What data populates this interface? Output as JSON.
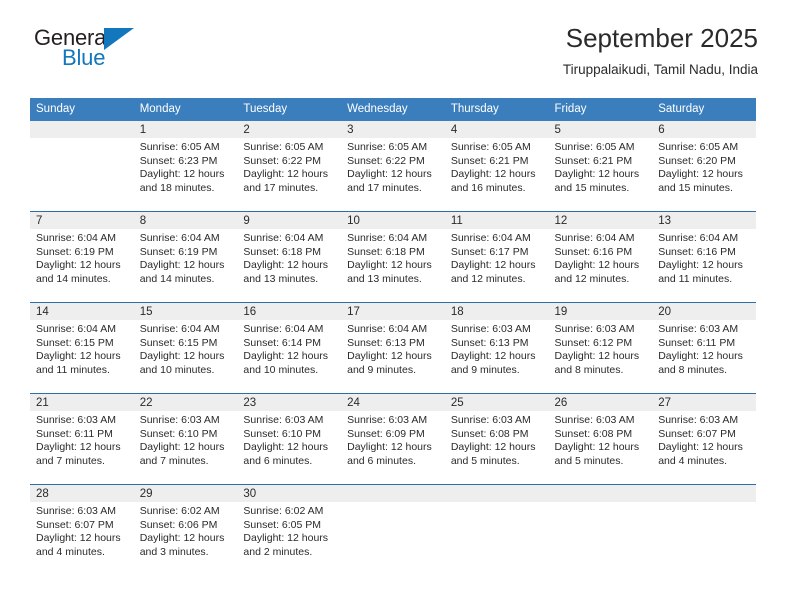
{
  "logo": {
    "text_top": "General",
    "text_bottom": "Blue",
    "triangle_icon": "triangle-icon",
    "color_dark": "#231f20",
    "color_blue": "#1277bc"
  },
  "header": {
    "title": "September 2025",
    "subtitle": "Tiruppalaikudi, Tamil Nadu, India"
  },
  "theme": {
    "header_blue": "#3b7ebe",
    "row_divider": "#2f6da8",
    "daynum_band": "#eeeeee",
    "text": "#2a2a2a"
  },
  "calendar": {
    "weekday_headers": [
      "Sunday",
      "Monday",
      "Tuesday",
      "Wednesday",
      "Thursday",
      "Friday",
      "Saturday"
    ],
    "labels": {
      "sunrise": "Sunrise:",
      "sunset": "Sunset:",
      "daylight": "Daylight:"
    },
    "weeks": [
      [
        {
          "day": "",
          "sunrise": "",
          "sunset": "",
          "daylight_line1": "",
          "daylight_line2": ""
        },
        {
          "day": "1",
          "sunrise": "Sunrise: 6:05 AM",
          "sunset": "Sunset: 6:23 PM",
          "daylight_line1": "Daylight: 12 hours",
          "daylight_line2": "and 18 minutes."
        },
        {
          "day": "2",
          "sunrise": "Sunrise: 6:05 AM",
          "sunset": "Sunset: 6:22 PM",
          "daylight_line1": "Daylight: 12 hours",
          "daylight_line2": "and 17 minutes."
        },
        {
          "day": "3",
          "sunrise": "Sunrise: 6:05 AM",
          "sunset": "Sunset: 6:22 PM",
          "daylight_line1": "Daylight: 12 hours",
          "daylight_line2": "and 17 minutes."
        },
        {
          "day": "4",
          "sunrise": "Sunrise: 6:05 AM",
          "sunset": "Sunset: 6:21 PM",
          "daylight_line1": "Daylight: 12 hours",
          "daylight_line2": "and 16 minutes."
        },
        {
          "day": "5",
          "sunrise": "Sunrise: 6:05 AM",
          "sunset": "Sunset: 6:21 PM",
          "daylight_line1": "Daylight: 12 hours",
          "daylight_line2": "and 15 minutes."
        },
        {
          "day": "6",
          "sunrise": "Sunrise: 6:05 AM",
          "sunset": "Sunset: 6:20 PM",
          "daylight_line1": "Daylight: 12 hours",
          "daylight_line2": "and 15 minutes."
        }
      ],
      [
        {
          "day": "7",
          "sunrise": "Sunrise: 6:04 AM",
          "sunset": "Sunset: 6:19 PM",
          "daylight_line1": "Daylight: 12 hours",
          "daylight_line2": "and 14 minutes."
        },
        {
          "day": "8",
          "sunrise": "Sunrise: 6:04 AM",
          "sunset": "Sunset: 6:19 PM",
          "daylight_line1": "Daylight: 12 hours",
          "daylight_line2": "and 14 minutes."
        },
        {
          "day": "9",
          "sunrise": "Sunrise: 6:04 AM",
          "sunset": "Sunset: 6:18 PM",
          "daylight_line1": "Daylight: 12 hours",
          "daylight_line2": "and 13 minutes."
        },
        {
          "day": "10",
          "sunrise": "Sunrise: 6:04 AM",
          "sunset": "Sunset: 6:18 PM",
          "daylight_line1": "Daylight: 12 hours",
          "daylight_line2": "and 13 minutes."
        },
        {
          "day": "11",
          "sunrise": "Sunrise: 6:04 AM",
          "sunset": "Sunset: 6:17 PM",
          "daylight_line1": "Daylight: 12 hours",
          "daylight_line2": "and 12 minutes."
        },
        {
          "day": "12",
          "sunrise": "Sunrise: 6:04 AM",
          "sunset": "Sunset: 6:16 PM",
          "daylight_line1": "Daylight: 12 hours",
          "daylight_line2": "and 12 minutes."
        },
        {
          "day": "13",
          "sunrise": "Sunrise: 6:04 AM",
          "sunset": "Sunset: 6:16 PM",
          "daylight_line1": "Daylight: 12 hours",
          "daylight_line2": "and 11 minutes."
        }
      ],
      [
        {
          "day": "14",
          "sunrise": "Sunrise: 6:04 AM",
          "sunset": "Sunset: 6:15 PM",
          "daylight_line1": "Daylight: 12 hours",
          "daylight_line2": "and 11 minutes."
        },
        {
          "day": "15",
          "sunrise": "Sunrise: 6:04 AM",
          "sunset": "Sunset: 6:15 PM",
          "daylight_line1": "Daylight: 12 hours",
          "daylight_line2": "and 10 minutes."
        },
        {
          "day": "16",
          "sunrise": "Sunrise: 6:04 AM",
          "sunset": "Sunset: 6:14 PM",
          "daylight_line1": "Daylight: 12 hours",
          "daylight_line2": "and 10 minutes."
        },
        {
          "day": "17",
          "sunrise": "Sunrise: 6:04 AM",
          "sunset": "Sunset: 6:13 PM",
          "daylight_line1": "Daylight: 12 hours",
          "daylight_line2": "and 9 minutes."
        },
        {
          "day": "18",
          "sunrise": "Sunrise: 6:03 AM",
          "sunset": "Sunset: 6:13 PM",
          "daylight_line1": "Daylight: 12 hours",
          "daylight_line2": "and 9 minutes."
        },
        {
          "day": "19",
          "sunrise": "Sunrise: 6:03 AM",
          "sunset": "Sunset: 6:12 PM",
          "daylight_line1": "Daylight: 12 hours",
          "daylight_line2": "and 8 minutes."
        },
        {
          "day": "20",
          "sunrise": "Sunrise: 6:03 AM",
          "sunset": "Sunset: 6:11 PM",
          "daylight_line1": "Daylight: 12 hours",
          "daylight_line2": "and 8 minutes."
        }
      ],
      [
        {
          "day": "21",
          "sunrise": "Sunrise: 6:03 AM",
          "sunset": "Sunset: 6:11 PM",
          "daylight_line1": "Daylight: 12 hours",
          "daylight_line2": "and 7 minutes."
        },
        {
          "day": "22",
          "sunrise": "Sunrise: 6:03 AM",
          "sunset": "Sunset: 6:10 PM",
          "daylight_line1": "Daylight: 12 hours",
          "daylight_line2": "and 7 minutes."
        },
        {
          "day": "23",
          "sunrise": "Sunrise: 6:03 AM",
          "sunset": "Sunset: 6:10 PM",
          "daylight_line1": "Daylight: 12 hours",
          "daylight_line2": "and 6 minutes."
        },
        {
          "day": "24",
          "sunrise": "Sunrise: 6:03 AM",
          "sunset": "Sunset: 6:09 PM",
          "daylight_line1": "Daylight: 12 hours",
          "daylight_line2": "and 6 minutes."
        },
        {
          "day": "25",
          "sunrise": "Sunrise: 6:03 AM",
          "sunset": "Sunset: 6:08 PM",
          "daylight_line1": "Daylight: 12 hours",
          "daylight_line2": "and 5 minutes."
        },
        {
          "day": "26",
          "sunrise": "Sunrise: 6:03 AM",
          "sunset": "Sunset: 6:08 PM",
          "daylight_line1": "Daylight: 12 hours",
          "daylight_line2": "and 5 minutes."
        },
        {
          "day": "27",
          "sunrise": "Sunrise: 6:03 AM",
          "sunset": "Sunset: 6:07 PM",
          "daylight_line1": "Daylight: 12 hours",
          "daylight_line2": "and 4 minutes."
        }
      ],
      [
        {
          "day": "28",
          "sunrise": "Sunrise: 6:03 AM",
          "sunset": "Sunset: 6:07 PM",
          "daylight_line1": "Daylight: 12 hours",
          "daylight_line2": "and 4 minutes."
        },
        {
          "day": "29",
          "sunrise": "Sunrise: 6:02 AM",
          "sunset": "Sunset: 6:06 PM",
          "daylight_line1": "Daylight: 12 hours",
          "daylight_line2": "and 3 minutes."
        },
        {
          "day": "30",
          "sunrise": "Sunrise: 6:02 AM",
          "sunset": "Sunset: 6:05 PM",
          "daylight_line1": "Daylight: 12 hours",
          "daylight_line2": "and 2 minutes."
        },
        {
          "day": "",
          "sunrise": "",
          "sunset": "",
          "daylight_line1": "",
          "daylight_line2": ""
        },
        {
          "day": "",
          "sunrise": "",
          "sunset": "",
          "daylight_line1": "",
          "daylight_line2": ""
        },
        {
          "day": "",
          "sunrise": "",
          "sunset": "",
          "daylight_line1": "",
          "daylight_line2": ""
        },
        {
          "day": "",
          "sunrise": "",
          "sunset": "",
          "daylight_line1": "",
          "daylight_line2": ""
        }
      ]
    ]
  }
}
